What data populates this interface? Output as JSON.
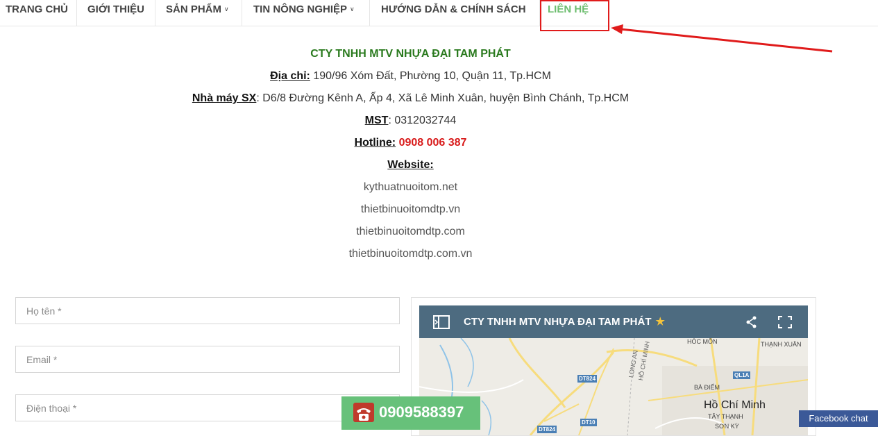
{
  "nav": {
    "items": [
      {
        "label": "TRANG CHỦ"
      },
      {
        "label": "GIỚI THIỆU"
      },
      {
        "label": "SẢN PHẨM"
      },
      {
        "label": "TIN NÔNG NGHIỆP"
      },
      {
        "label": "HƯỚNG DẪN & CHÍNH SÁCH"
      },
      {
        "label": "LIÊN HỆ"
      }
    ],
    "dropdown_icon": "chevron-down-icon",
    "active_color": "#6cbd6e"
  },
  "annotation": {
    "color": "#e01b1b"
  },
  "contact": {
    "company": "CTY TNHH MTV NHỰA ĐẠI TAM PHÁT",
    "address_label": "Địa chỉ:",
    "address": " 190/96 Xóm Đất, Phường 10, Quận 11, Tp.HCM",
    "factory_label": "Nhà máy SX",
    "factory": ":  D6/8 Đường Kênh A, Ấp 4, Xã Lê Minh Xuân, huyện Bình Chánh, Tp.HCM",
    "tax_label": "MST",
    "tax": ": 0312032744",
    "hotline_label": "Hotline:",
    "hotline": "0908 006 387",
    "website_label": "Website:",
    "websites": [
      "kythuatnuoitom.net",
      "thietbinuoitomdtp.vn",
      "thietbinuoitomdtp.com",
      "thietbinuoitomdtp.com.vn"
    ]
  },
  "form": {
    "name_placeholder": "Họ tên *",
    "email_placeholder": "Email *",
    "phone_placeholder": "Điện thoại *"
  },
  "map": {
    "title": "CTY TNHH MTV NHỰA ĐẠI TAM PHÁT",
    "star": "★",
    "labels": {
      "hoc_mon": "HÓC MÔN",
      "thanh_xuan": "THẠNH XUÂN",
      "long_an": "LONG AN",
      "ho_chi_minh_road": "HỒ CHÍ MINH",
      "ba_diem": "BÀ ĐIỂM",
      "city": "Hồ Chí Minh",
      "tay_thanh": "TÂY THẠNH",
      "son_ky": "SƠN KỲ",
      "dt824": "DT824",
      "ql1a": "QL1A",
      "dt10": "DT10",
      "dt824b": "DT824"
    }
  },
  "floating": {
    "phone": "0909588397",
    "phone_color": "#67c17a",
    "facebook_chat": "Facebook chat"
  }
}
